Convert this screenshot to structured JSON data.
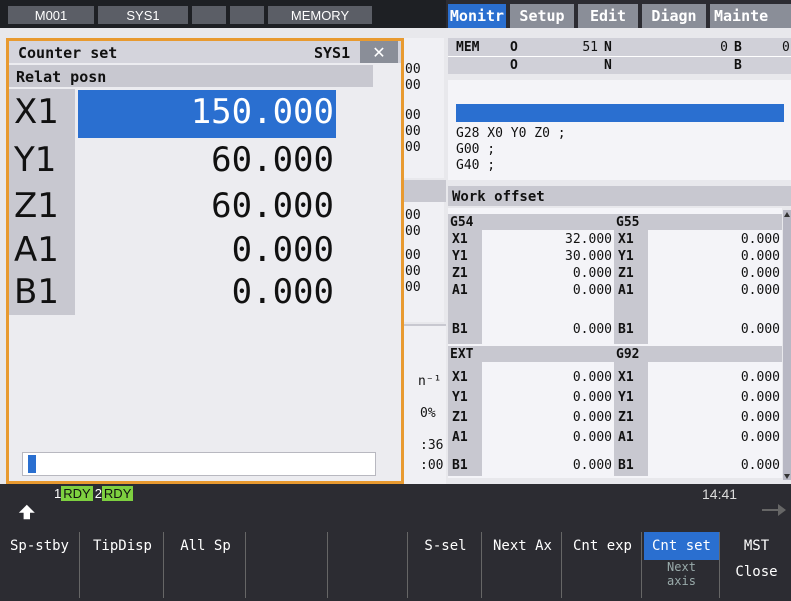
{
  "status": {
    "program": "M001",
    "system": "SYS1",
    "mode": "MEMORY"
  },
  "tabs": [
    {
      "label": "Monitr"
    },
    {
      "label": "Setup"
    },
    {
      "label": "Edit"
    },
    {
      "label": "Diagn"
    },
    {
      "label": "Mainte"
    }
  ],
  "mem": {
    "label": "MEM",
    "o1": "O",
    "o1v": "51",
    "n1": "N",
    "n1v": "0",
    "b1": "B",
    "b1v": "0",
    "o2": "O",
    "n2": "N",
    "b2": "B"
  },
  "program_lines": [
    "G28 X0 Y0 Z0 ;",
    "G00 ;",
    "G40 ;"
  ],
  "work_offset": {
    "title": "Work offset",
    "groups": [
      {
        "left_name": "G54",
        "right_name": "G55",
        "rows": [
          {
            "axis": "X1",
            "lv": "32.000",
            "rv": "0.000"
          },
          {
            "axis": "Y1",
            "lv": "30.000",
            "rv": "0.000"
          },
          {
            "axis": "Z1",
            "lv": "0.000",
            "rv": "0.000"
          },
          {
            "axis": "A1",
            "lv": "0.000",
            "rv": "0.000"
          },
          {
            "axis": "B1",
            "lv": "0.000",
            "rv": "0.000"
          }
        ]
      },
      {
        "left_name": "EXT",
        "right_name": "G92",
        "rows": [
          {
            "axis": "X1",
            "lv": "0.000",
            "rv": "0.000"
          },
          {
            "axis": "Y1",
            "lv": "0.000",
            "rv": "0.000"
          },
          {
            "axis": "Z1",
            "lv": "0.000",
            "rv": "0.000"
          },
          {
            "axis": "A1",
            "lv": "0.000",
            "rv": "0.000"
          },
          {
            "axis": "B1",
            "lv": "0.000",
            "rv": "0.000"
          }
        ]
      }
    ]
  },
  "bg_partial": {
    "r1": "00",
    "r2": "00",
    "r3": "00",
    "r4": "00",
    "r5": "00",
    "r6": "00",
    "r7": "00",
    "r8": "00",
    "r9": "00",
    "r10": "00",
    "unit": "n⁻¹",
    "pct": "0%",
    "t1": ":36",
    "t2": ":00"
  },
  "counter_set": {
    "title": "Counter set",
    "system": "SYS1",
    "close": "✕",
    "section": "Relat posn",
    "rows": [
      {
        "axis": "X1",
        "value": "150.000"
      },
      {
        "axis": "Y1",
        "value": "60.000"
      },
      {
        "axis": "Z1",
        "value": "60.000"
      },
      {
        "axis": "A1",
        "value": "0.000"
      },
      {
        "axis": "B1",
        "value": "0.000"
      }
    ],
    "input_value": ""
  },
  "bottom": {
    "rdy1": "1",
    "rdy1_label": "RDY",
    "rdy2": "2",
    "rdy2_label": "RDY",
    "time": "14:41"
  },
  "softkeys": [
    {
      "label": "Sp-stby",
      "sub": ""
    },
    {
      "label": "TipDisp",
      "sub": ""
    },
    {
      "label": "All Sp",
      "sub": ""
    },
    {
      "label": "",
      "sub": ""
    },
    {
      "label": "",
      "sub": ""
    },
    {
      "label": "S-sel",
      "sub": ""
    },
    {
      "label": "Next Ax",
      "sub": ""
    },
    {
      "label": "Cnt exp",
      "sub": ""
    },
    {
      "label": "Cnt set",
      "sub": "Next axis"
    },
    {
      "label": "MST",
      "sub": "Close"
    }
  ]
}
